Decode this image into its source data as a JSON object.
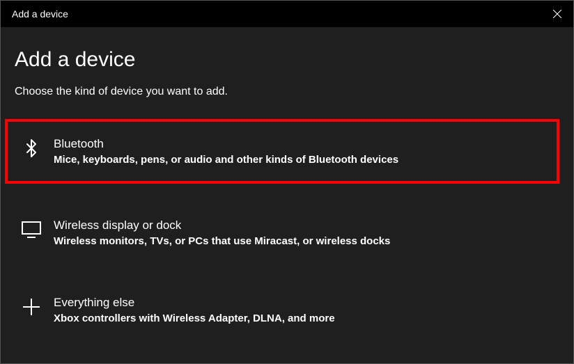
{
  "titlebar": {
    "title": "Add a device"
  },
  "main": {
    "heading": "Add a device",
    "subheading": "Choose the kind of device you want to add.",
    "options": [
      {
        "title": "Bluetooth",
        "description": "Mice, keyboards, pens, or audio and other kinds of Bluetooth devices"
      },
      {
        "title": "Wireless display or dock",
        "description": "Wireless monitors, TVs, or PCs that use Miracast, or wireless docks"
      },
      {
        "title": "Everything else",
        "description": "Xbox controllers with Wireless Adapter, DLNA, and more"
      }
    ]
  }
}
